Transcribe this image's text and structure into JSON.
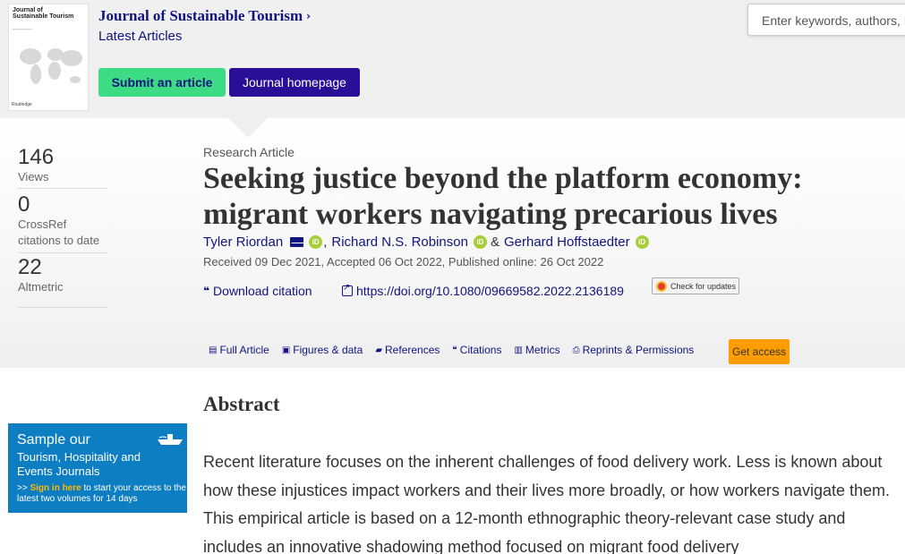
{
  "header": {
    "cover": {
      "title": "Journal of Sustainable Tourism",
      "publisher": "Routledge"
    },
    "journal_title": "Journal of Sustainable Tourism",
    "journal_chevron": "›",
    "latest_articles": "Latest Articles",
    "submit_button": "Submit an article",
    "homepage_button": "Journal homepage",
    "search_placeholder": "Enter keywords, authors, DOI, ORCID etc"
  },
  "metrics": [
    {
      "value": "146",
      "label": "Views"
    },
    {
      "value": "0",
      "label": "CrossRef citations to date"
    },
    {
      "value": "22",
      "label": "Altmetric"
    }
  ],
  "article": {
    "type": "Research Article",
    "title": "Seeking justice beyond the platform economy: migrant workers navigating precarious lives",
    "authors": [
      {
        "name": "Tyler Riordan"
      },
      {
        "name": "Richard N.S. Robinson"
      },
      {
        "name": "Gerhard Hoffstaedter"
      }
    ],
    "author_sep_comma": ",",
    "author_sep_amp": "&",
    "dates": "Received 09 Dec 2021, Accepted 06 Oct 2022, Published online: 26 Oct 2022",
    "download_citation": "Download citation",
    "doi": "https://doi.org/10.1080/09669582.2022.2136189",
    "check_updates": "Check for updates",
    "orcid_label": "iD"
  },
  "tabs": [
    {
      "icon": "full-article-icon",
      "label": "Full Article"
    },
    {
      "icon": "figures-icon",
      "label": "Figures & data"
    },
    {
      "icon": "references-icon",
      "label": "References"
    },
    {
      "icon": "citations-icon",
      "label": "Citations"
    },
    {
      "icon": "metrics-icon",
      "label": "Metrics"
    },
    {
      "icon": "print-icon",
      "label": "Reprints & Permissions"
    }
  ],
  "get_access": "Get access",
  "abstract": {
    "heading": "Abstract",
    "body": "Recent literature focuses on the inherent challenges of food delivery work. Less is known about how these injustices impact workers and their lives more broadly, or how workers navigate them. This empirical article is based on a 12-month ethnographic theory-relevant case study and includes an innovative shadowing method focused on migrant food delivery"
  },
  "promo": {
    "line1": "Sample our",
    "line2": "Tourism, Hospitality and Events Journals",
    "prefix": ">> ",
    "link": "Sign in here",
    "rest": " to start your access to the latest two volumes for 14 days"
  },
  "colors": {
    "brand_navy": "#10147e",
    "submit_green": "#3ddc84",
    "homepage_purple": "#2a0e97",
    "access_orange": "#ff9c00",
    "promo_blue": "#0e7ec2",
    "orcid_green": "#a6ce39"
  }
}
